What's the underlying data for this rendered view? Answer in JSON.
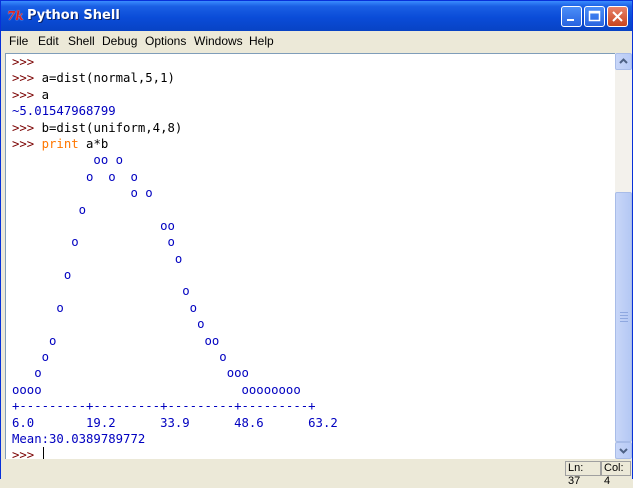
{
  "window": {
    "title": "Python Shell",
    "icon_text": "7k",
    "colors": {
      "titlebar": "#0A4CD8",
      "prompt": "#7A0000",
      "output": "#0000C0",
      "keyword": "#FF7700"
    }
  },
  "menu": [
    "File",
    "Edit",
    "Shell",
    "Debug",
    "Options",
    "Windows",
    "Help"
  ],
  "shell": {
    "lines": [
      {
        "prompt": ">>>",
        "code": ""
      },
      {
        "prompt": ">>>",
        "code": " a=dist(normal,5,1)"
      },
      {
        "prompt": ">>>",
        "code": " a"
      },
      {
        "output": "~5.01547968799"
      },
      {
        "prompt": ">>>",
        "code": " b=dist(uniform,4,8)"
      },
      {
        "prompt": ">>>",
        "keyword": " print",
        "code": " a*b"
      },
      {
        "output": "           oo o"
      },
      {
        "output": "          o  o  o"
      },
      {
        "output": "                o o"
      },
      {
        "output": "         o"
      },
      {
        "output": "                    oo"
      },
      {
        "output": "        o            o"
      },
      {
        "output": "                      o"
      },
      {
        "output": "       o"
      },
      {
        "output": "                       o"
      },
      {
        "output": "      o                 o"
      },
      {
        "output": "                         o"
      },
      {
        "output": "     o                    oo"
      },
      {
        "output": "    o                       o"
      },
      {
        "output": "   o                         ooo"
      },
      {
        "output": "oooo                           oooooooo"
      },
      {
        "output": "+---------+---------+---------+---------+"
      },
      {
        "output": "6.0       19.2      33.9      48.6      63.2"
      },
      {
        "output": "Mean:30.0389789772"
      },
      {
        "prompt": ">>>",
        "code": " "
      }
    ]
  },
  "status": {
    "line": "Ln: 37",
    "col": "Col: 4"
  }
}
